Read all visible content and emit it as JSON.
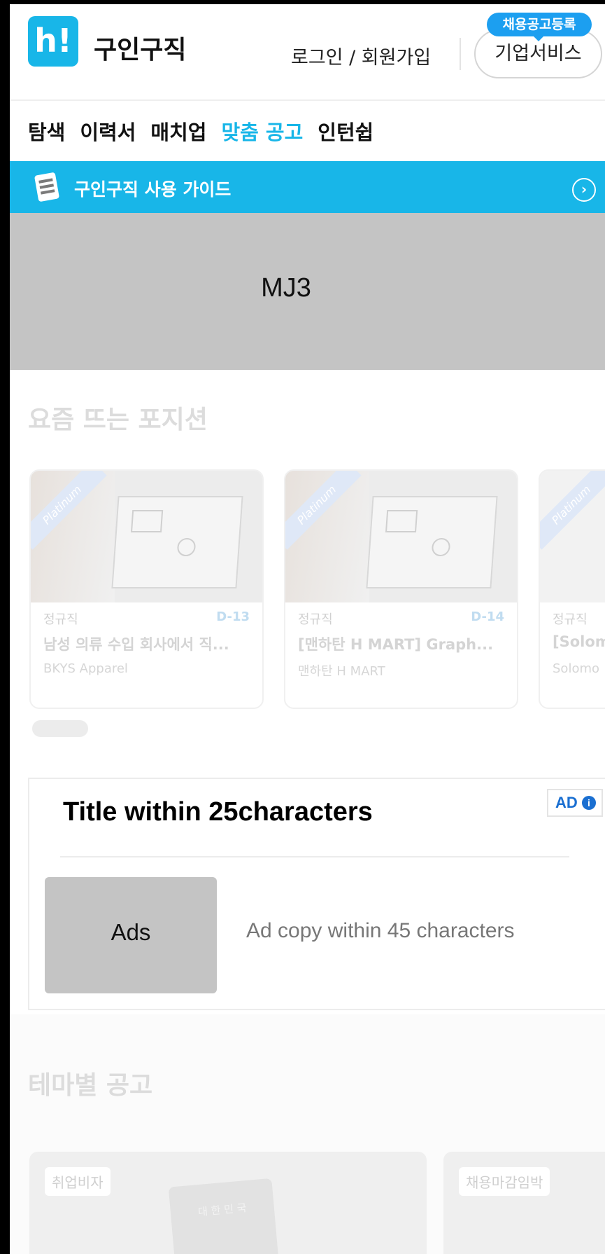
{
  "header": {
    "logo_mark": "h!",
    "logo_text": "구인구직",
    "login_label": "로그인 / 회원가입",
    "business_button": "기업서비스",
    "recruit_badge": "채용공고등록"
  },
  "nav": {
    "items": [
      {
        "label": "탐색",
        "active": false
      },
      {
        "label": "이력서",
        "active": false
      },
      {
        "label": "매치업",
        "active": false
      },
      {
        "label": "맞춤 공고",
        "active": true
      },
      {
        "label": "인턴쉽",
        "active": false
      }
    ]
  },
  "guide_bar": {
    "text": "구인구직 사용 가이드",
    "arrow": "›"
  },
  "banner": {
    "label": "MJ3"
  },
  "trending": {
    "title": "요즘 뜨는 포지션",
    "cards": [
      {
        "ribbon": "Platinum",
        "type": "정규직",
        "dday": "D-13",
        "title": "남성 의류 수입 회사에서 직...",
        "company": "BKYS Apparel"
      },
      {
        "ribbon": "Platinum",
        "type": "정규직",
        "dday": "D-14",
        "title": "[맨하탄 H MART] Graph...",
        "company": "맨하탄 H MART"
      },
      {
        "ribbon": "Platinum",
        "type": "정규직",
        "dday": "",
        "title": "[Solom",
        "company": "Solomo"
      }
    ]
  },
  "ad": {
    "title": "Title within 25characters",
    "badge": "AD",
    "badge_icon": "i",
    "image_label": "Ads",
    "copy": "Ad copy within 45 characters"
  },
  "theme": {
    "title": "테마별 공고",
    "cards": [
      {
        "tag": "취업비자",
        "passport_text": "대 한 민 국"
      },
      {
        "tag": "채용마감임박"
      }
    ]
  },
  "colors": {
    "brand": "#18b6e8",
    "badge": "#1c9ff0",
    "ad_blue": "#1a6fd1"
  }
}
